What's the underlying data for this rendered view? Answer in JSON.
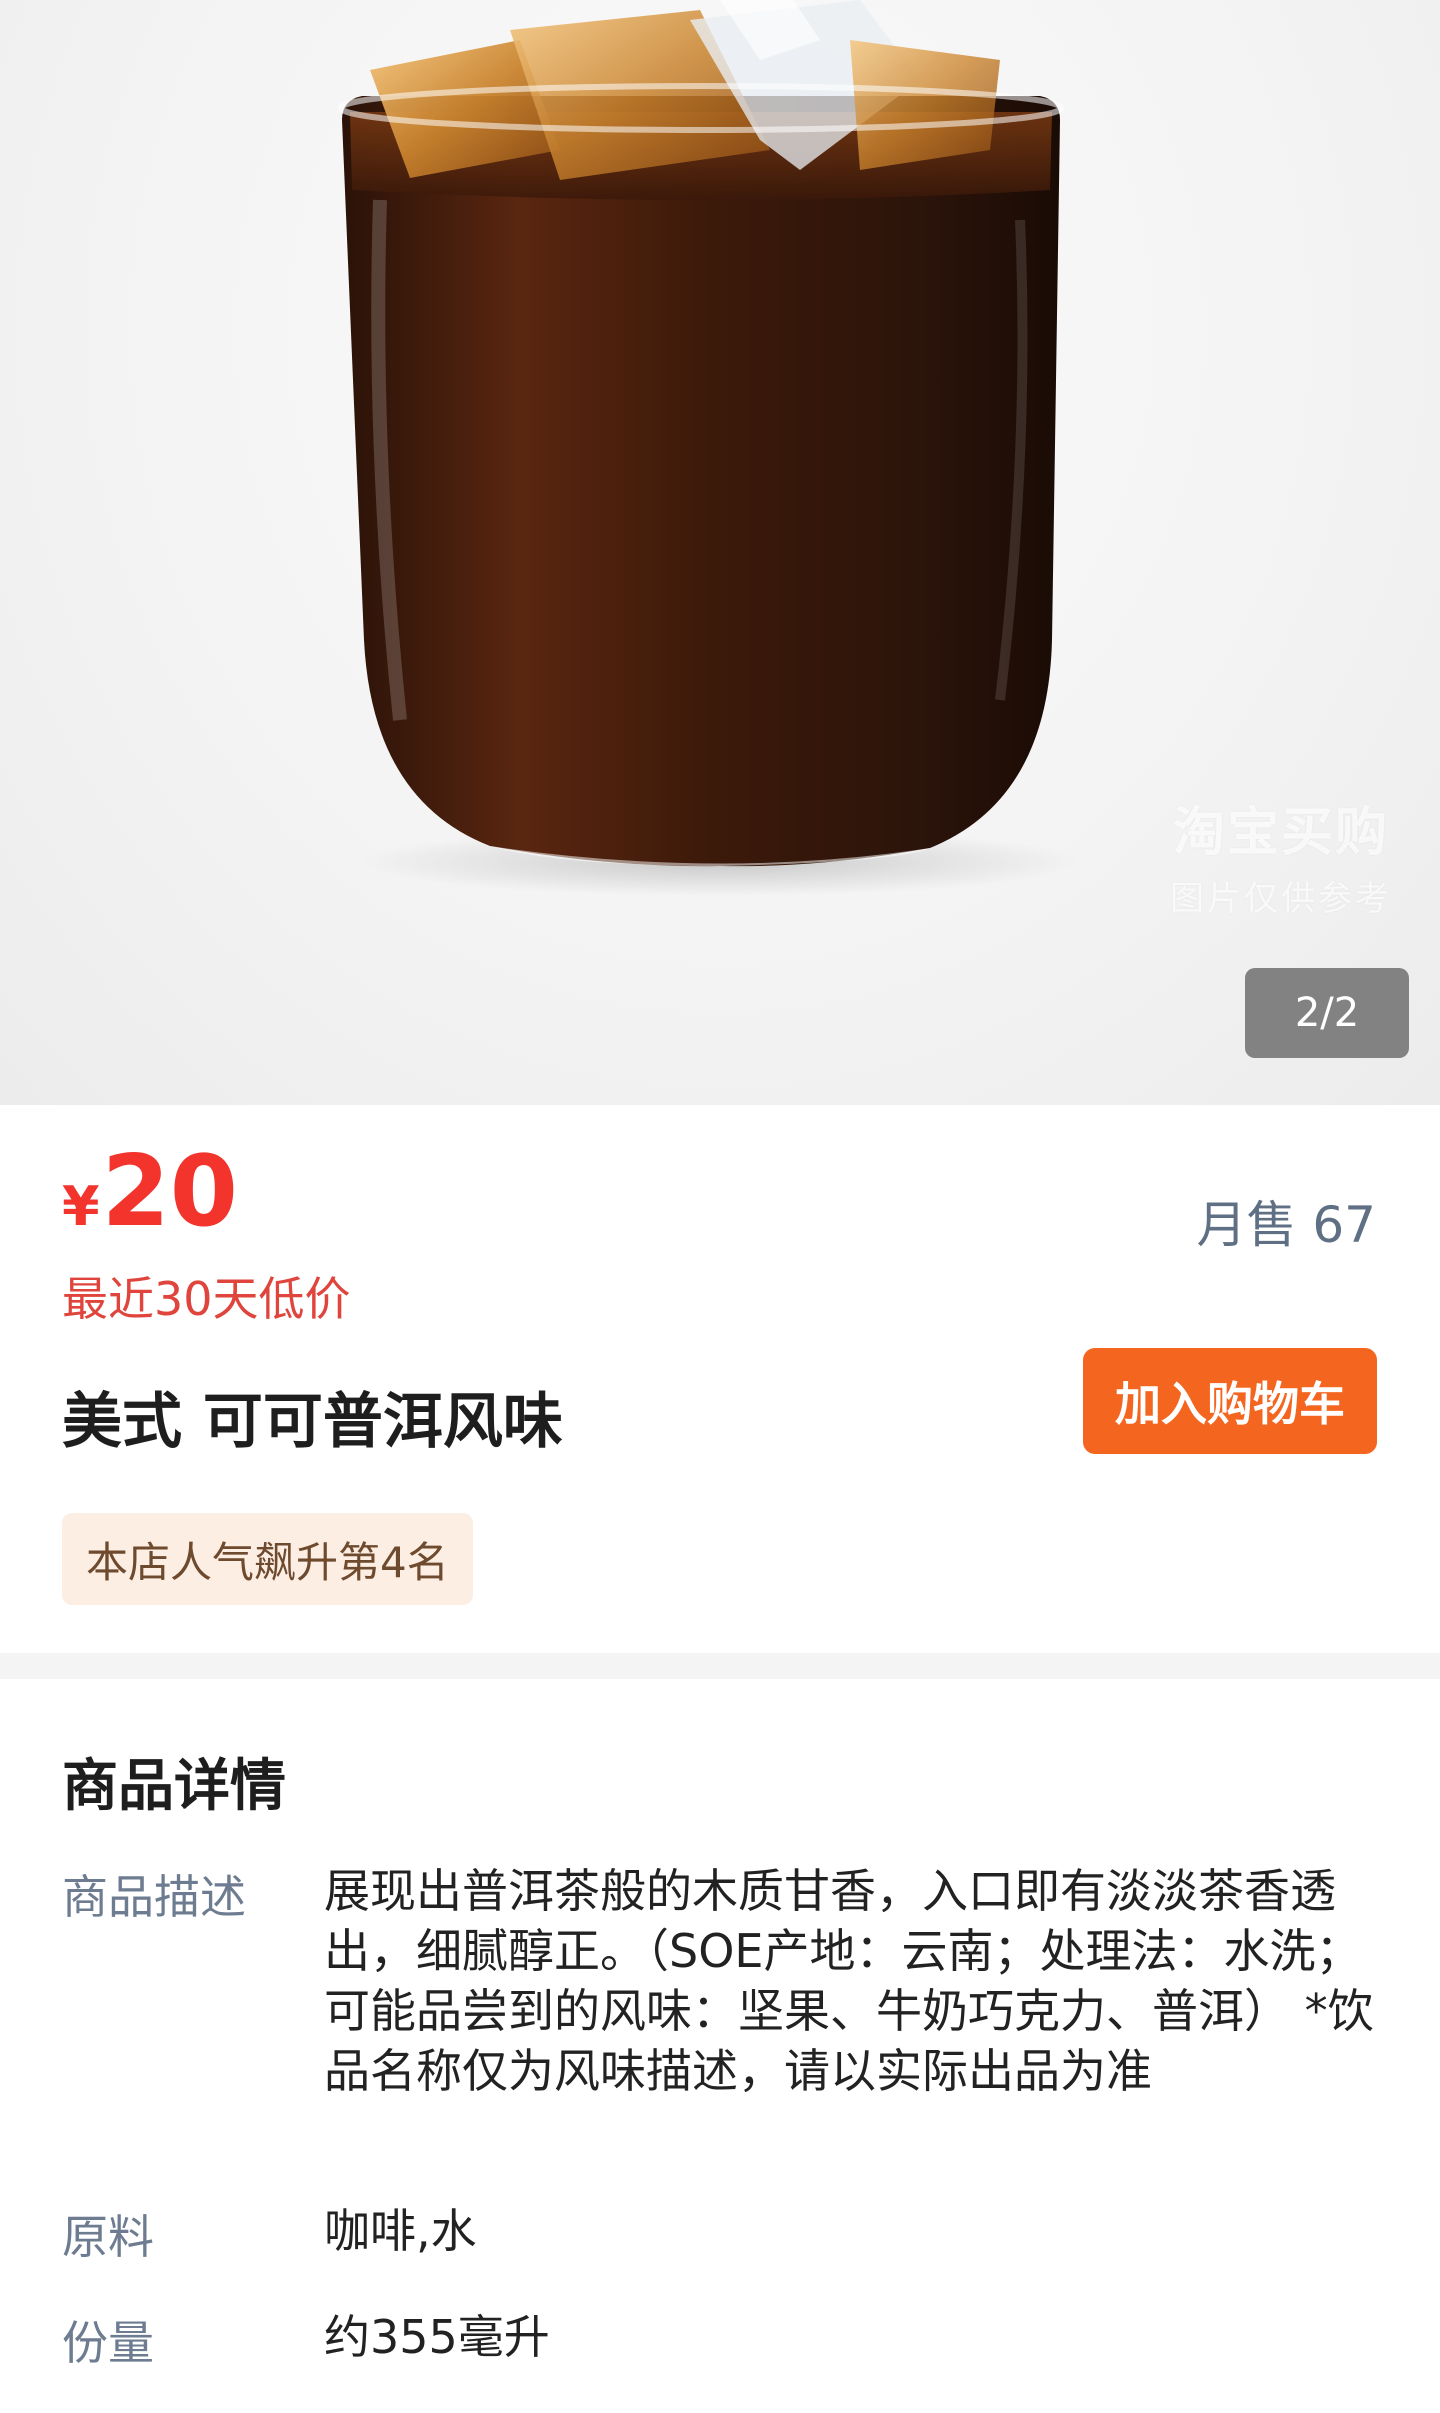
{
  "gallery": {
    "counter": "2/2",
    "watermark_line1": "淘宝买购",
    "watermark_line2": "图片仅供参考"
  },
  "product": {
    "currency": "¥",
    "price": "20",
    "monthly_sales": "月售 67",
    "low_price_note": "最近30天低价",
    "name": "美式 可可普洱风味",
    "add_to_cart_label": "加入购物车",
    "rank_badge": "本店人气飙升第4名"
  },
  "details": {
    "title": "商品详情",
    "rows": [
      {
        "label": "商品描述",
        "value": "展现出普洱茶般的木质甘香，入口即有淡淡茶香透出，细腻醇正。（SOE产地：云南；处理法：水洗；可能品尝到的风味：坚果、牛奶巧克力、普洱） *饮品名称仅为风味描述，请以实际出品为准"
      },
      {
        "label": "原料",
        "value": "咖啡,水"
      },
      {
        "label": "份量",
        "value": "约355毫升"
      }
    ]
  },
  "colors": {
    "price_red": "#f2342c",
    "cart_orange": "#f4651f",
    "badge_bg": "#fdeee4",
    "label_gray": "#6d7c90"
  }
}
